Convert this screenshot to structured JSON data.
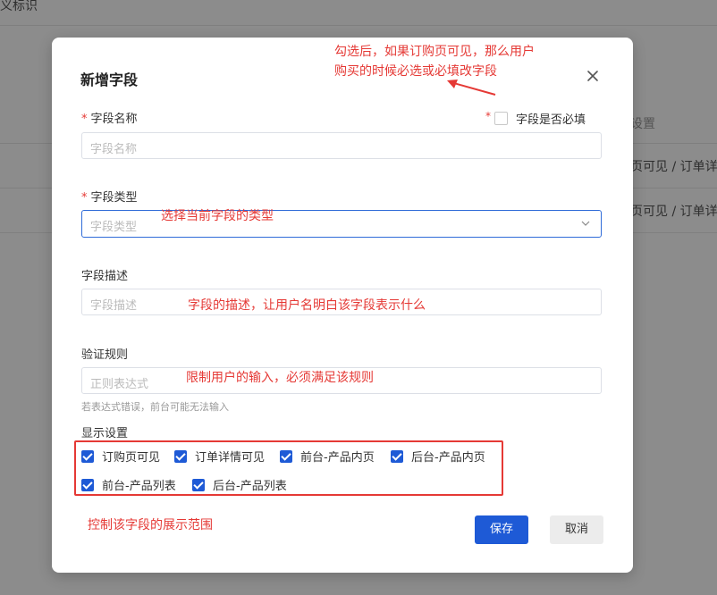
{
  "background": {
    "top_text": "义标识",
    "col_header": "设置",
    "row1": "页可见 / 订单详情",
    "row2": "页可见 / 订单详情"
  },
  "modal": {
    "title": "新增字段",
    "close_icon": "close-icon",
    "required_checkbox_label": "字段是否必填",
    "field_name": {
      "label": "字段名称",
      "placeholder": "字段名称"
    },
    "field_type": {
      "label": "字段类型",
      "placeholder": "字段类型"
    },
    "field_desc": {
      "label": "字段描述",
      "placeholder": "字段描述"
    },
    "validation": {
      "label": "验证规则",
      "placeholder": "正则表达式",
      "hint": "若表达式错误，前台可能无法输入"
    },
    "display": {
      "label": "显示设置",
      "options": [
        {
          "label": "订购页可见",
          "checked": true
        },
        {
          "label": "订单详情可见",
          "checked": true
        },
        {
          "label": "前台-产品内页",
          "checked": true
        },
        {
          "label": "后台-产品内页",
          "checked": true
        },
        {
          "label": "前台-产品列表",
          "checked": true
        },
        {
          "label": "后台-产品列表",
          "checked": true
        }
      ]
    },
    "save_label": "保存",
    "cancel_label": "取消"
  },
  "annotations": {
    "required_note_line1": "勾选后，如果订购页可见，那么用户",
    "required_note_line2": "购买的时候必选或必填改字段",
    "type_note": "选择当前字段的类型",
    "desc_note": "字段的描述，让用户名明白该字段表示什么",
    "validation_note": "限制用户的输入，必须满足该规则",
    "display_note": "控制该字段的展示范围"
  },
  "colors": {
    "accent": "#1e5ad6",
    "annotation": "#e53935"
  }
}
